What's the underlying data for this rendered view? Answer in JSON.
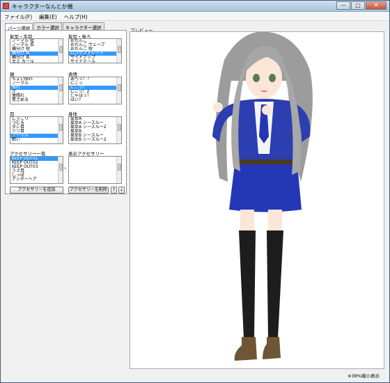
{
  "window": {
    "title": "キャラクターなんとか機",
    "min": "—",
    "max": "□",
    "close": "✕"
  },
  "menu": [
    "ファイル(F)",
    "編集(E)",
    "ヘルプ(H)"
  ],
  "tabs": [
    "パーツ選択",
    "カラー選択",
    "キャラクター選択"
  ],
  "groups": {
    "hair_front": {
      "label": "髪型・手前",
      "items": [
        "ノーマル 短",
        "ノーマル 長",
        "横分け 短",
        "横分け 長",
        "横分け 長",
        "セミ カール"
      ],
      "selected": 3
    },
    "hair_back": {
      "label": "髪型・後ろ",
      "items": [
        "おだんご",
        "おだんご ウェーブ",
        "おだんご 短",
        "ロングストレート",
        "サイドアップ",
        "サイドテール"
      ],
      "selected": 3
    },
    "cheek": {
      "label": "頬",
      "items": [
        "ちょい照れ",
        "ノーマル",
        "照れ",
        "汗",
        "激照れ",
        "青ざめる"
      ],
      "selected": 2
    },
    "expression": {
      "label": "表情",
      "items": [
        "あへっ！？",
        "にこっ",
        "にこっ！",
        "にこっ！2",
        "じゃはっ！",
        "はい？"
      ],
      "selected": 2
    },
    "eyes": {
      "label": "目",
      "items": [
        "にっこり",
        "つむる",
        "タレ目",
        "ツリ目",
        "ノーマル",
        "眠い"
      ],
      "selected": 4
    },
    "body": {
      "label": "身体",
      "items": [
        "巫女A",
        "巫女A シースルー",
        "巫女A シースルー2",
        "巫女B",
        "巫女B シースルー",
        "巫女B シースルー2"
      ],
      "selected": -1
    },
    "accessory_list": {
      "label": "アクセサリー一覧",
      "items": [
        "KEEP OUT01",
        "KEEP OUT02",
        "KEEP OUT03",
        "うさ耳",
        "しっぽ",
        "アンダーヘア"
      ],
      "selected": 0
    },
    "shown_accessory": {
      "label": "表示アクセサリー",
      "items": [],
      "selected": -1
    }
  },
  "buttons": {
    "add": "アクセサリーを追加",
    "remove": "アクセサリーを削除",
    "up": "↑",
    "down": "↓",
    "move": "›"
  },
  "preview": {
    "label": "プレビュー",
    "status": "※38%縮小表示"
  },
  "colors": {
    "hair": "#9c9c9c",
    "jacket": "#2b3fb0",
    "skirt": "#2438b6",
    "stockings": "#1d1d1d",
    "boots": "#6e5535",
    "skin": "#fbe6d8",
    "selection": "#3399ff"
  }
}
